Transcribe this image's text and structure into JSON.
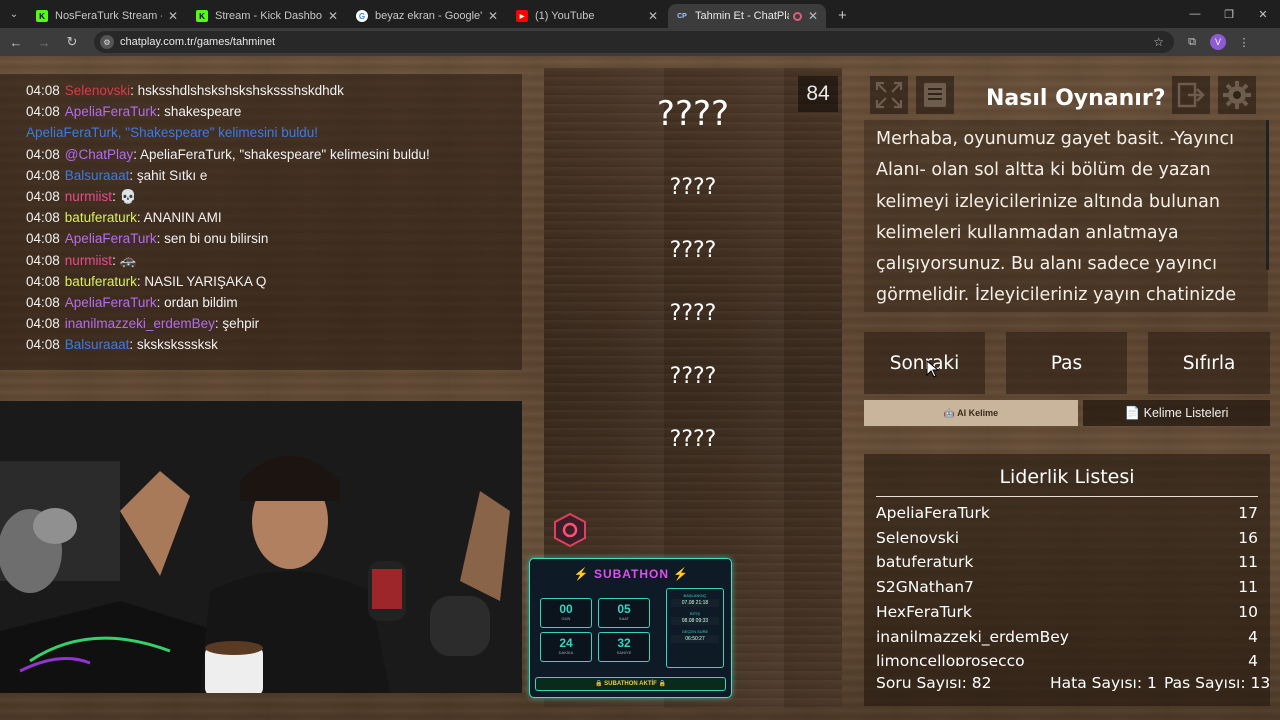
{
  "browser": {
    "tabs": [
      {
        "title": "NosFeraTurk Stream - Kick Dash",
        "favicon": "K",
        "color": "#53fc18"
      },
      {
        "title": "Stream - Kick Dashboard",
        "favicon": "K",
        "color": "#53fc18"
      },
      {
        "title": "beyaz ekran - Google'da Ara",
        "favicon": "G",
        "color": "#ffffff"
      },
      {
        "title": "(1) YouTube",
        "favicon": "▶",
        "color": "#ff0000"
      },
      {
        "title": "Tahmin Et - ChatPlay",
        "favicon": "CP",
        "color": "#3c3c3c"
      }
    ],
    "url": "chatplay.com.tr/games/tahminet",
    "profile_initial": "V"
  },
  "chat": [
    {
      "time": "04:08",
      "user": "Selenovski",
      "color": "#e0384a",
      "msg": ": hsksshdlshskshskshskssshskdhdk"
    },
    {
      "time": "04:08",
      "user": "ApeliaFeraTurk",
      "color": "#b46cf0",
      "msg": ": shakespeare"
    },
    {
      "time": "",
      "user": "ApeliaFeraTurk, \"Shakespeare\" kelimesini buldu!",
      "color": "#3a7be8",
      "msg": ""
    },
    {
      "time": "04:08",
      "user": "@ChatPlay",
      "color": "#b46cf0",
      "msg": ": ApeliaFeraTurk, \"shakespeare\" kelimesini buldu!"
    },
    {
      "time": "04:08",
      "user": "Balsuraaat",
      "color": "#3a7be8",
      "msg": ": şahit Sıtkı e"
    },
    {
      "time": "04:08",
      "user": "nurmiist",
      "color": "#e84a90",
      "msg": ": 💀"
    },
    {
      "time": "04:08",
      "user": "batuferaturk",
      "color": "#d8f05a",
      "msg": ": ANANIN AMI"
    },
    {
      "time": "04:08",
      "user": "ApeliaFeraTurk",
      "color": "#b46cf0",
      "msg": ": sen bi onu bilirsin"
    },
    {
      "time": "04:08",
      "user": "nurmiist",
      "color": "#e84a90",
      "msg": ": 🚓"
    },
    {
      "time": "04:08",
      "user": "batuferaturk",
      "color": "#d8f05a",
      "msg": ": NASIL YARIŞAKA Q"
    },
    {
      "time": "04:08",
      "user": "ApeliaFeraTurk",
      "color": "#b46cf0",
      "msg": ": ordan bildim"
    },
    {
      "time": "04:08",
      "user": "inanilmazzeki_erdemBey",
      "color": "#b46cf0",
      "msg": ": şehpir"
    },
    {
      "time": "04:08",
      "user": "Balsuraaat",
      "color": "#3a7be8",
      "msg": ": sksksksssksk"
    }
  ],
  "words": [
    "????",
    "????",
    "????",
    "????",
    "????",
    "????"
  ],
  "counter": "84",
  "subathon": {
    "title": "SUBATHON",
    "boxes": [
      {
        "num": "00",
        "label": "GÜN"
      },
      {
        "num": "05",
        "label": "SAAT"
      },
      {
        "num": "24",
        "label": "DAKİKA"
      },
      {
        "num": "32",
        "label": "SANİYE"
      }
    ],
    "side": [
      {
        "label": "BAŞLANGIÇ",
        "value": "07.08 21:18"
      },
      {
        "label": "BİTİŞ",
        "value": "08.08 09:33"
      },
      {
        "label": "GEÇEN SÜRE",
        "value": "06:50:27"
      }
    ],
    "footer": "🔒 SUBATHON AKTİF 🔒"
  },
  "howto": {
    "title": "Nasıl Oynanır?",
    "text": "Merhaba, oyunumuz gayet basit. -Yayıncı Alanı- olan sol altta ki bölüm de yazan kelimeyi izleyicilerinize altında bulunan kelimeleri kullanmadan anlatmaya çalışıyorsunuz. Bu alanı sadece yayıncı görmelidir. İzleyicileriniz yayın chatinizde ..."
  },
  "actions": {
    "next": "Sonraki",
    "pass": "Pas",
    "reset": "Sıfırla"
  },
  "tabs": {
    "ai": "🤖 AI Kelime",
    "lists": "📄 Kelime Listeleri"
  },
  "leaderboard": {
    "title": "Liderlik Listesi",
    "rows": [
      {
        "name": "ApeliaFeraTurk",
        "score": "17"
      },
      {
        "name": "Selenovski",
        "score": "16"
      },
      {
        "name": "batuferaturk",
        "score": "11"
      },
      {
        "name": "S2GNathan7",
        "score": "11"
      },
      {
        "name": "HexFeraTurk",
        "score": "10"
      },
      {
        "name": "inanilmazzeki_erdemBey",
        "score": "4"
      },
      {
        "name": "limoncelloprosecco",
        "score": "4"
      }
    ],
    "stats": {
      "questions": "Soru Sayısı: 82",
      "errors": "Hata Sayısı: 1",
      "passes": "Pas Sayısı: 13"
    }
  }
}
